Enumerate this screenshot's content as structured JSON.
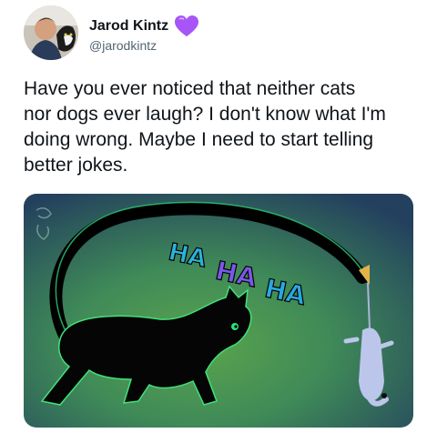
{
  "author": {
    "name": "Jarod Kintz",
    "handle": "@jarodkintz",
    "avatar_icon": "avatar-photo-person-with-cat",
    "badge_icon": "purple-heart-icon",
    "badge_color": "#a855f7"
  },
  "tweet": {
    "lines": [
      "Have you ever noticed that neither cats",
      "nor dogs ever laugh? I don't know what I'm",
      "doing wrong. Maybe I need to start telling",
      "better jokes."
    ]
  },
  "media": {
    "description_icon": "cat-chasing-mouse-illustration",
    "laugh_words": [
      "HA",
      "HA",
      "HA"
    ],
    "laugh_colors": [
      "#2bb3d9",
      "#7b57e8",
      "#2aa7e0"
    ],
    "background_colors": [
      "#2f6f66",
      "#4f9a4a",
      "#263f5c"
    ]
  }
}
